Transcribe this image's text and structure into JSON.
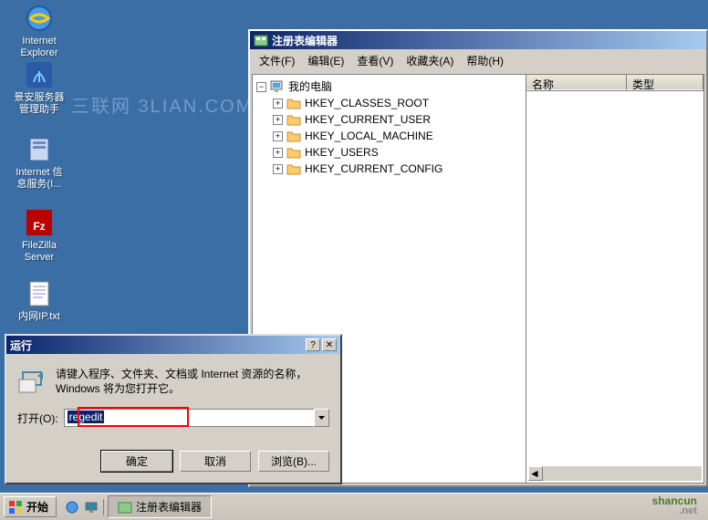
{
  "desktop": {
    "icons": [
      {
        "label": "Internet\nExplorer"
      },
      {
        "label": "景安服务器\n管理助手"
      },
      {
        "label": "Internet 信\n息服务(I..."
      },
      {
        "label": "FileZilla\nServer"
      },
      {
        "label": "内网IP.txt"
      }
    ]
  },
  "watermark": "三联网 3LIAN.COM",
  "regedit": {
    "title": "注册表编辑器",
    "menu": {
      "file": "文件(F)",
      "edit": "编辑(E)",
      "view": "查看(V)",
      "fav": "收藏夹(A)",
      "help": "帮助(H)"
    },
    "tree": {
      "root": "我的电脑",
      "keys": [
        "HKEY_CLASSES_ROOT",
        "HKEY_CURRENT_USER",
        "HKEY_LOCAL_MACHINE",
        "HKEY_USERS",
        "HKEY_CURRENT_CONFIG"
      ]
    },
    "list": {
      "col_name": "名称",
      "col_type": "类型"
    }
  },
  "run": {
    "title": "运行",
    "description": "请键入程序、文件夹、文档或 Internet 资源的名称，Windows 将为您打开它。",
    "open_label": "打开(O):",
    "input_value": "regedit",
    "btn_ok": "确定",
    "btn_cancel": "取消",
    "btn_browse": "浏览(B)..."
  },
  "taskbar": {
    "start": "开始",
    "task1": "注册表编辑器"
  },
  "brand": {
    "name": "shancun",
    "tld": ".net"
  }
}
